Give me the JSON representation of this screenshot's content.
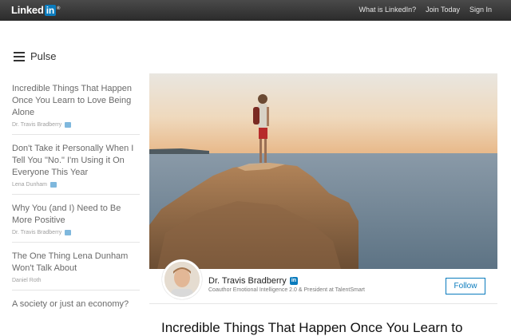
{
  "header": {
    "logo_text": "Linked",
    "logo_in": "in",
    "logo_reg": "®",
    "links": [
      "What is LinkedIn?",
      "Join Today",
      "Sign In"
    ]
  },
  "pulse": {
    "label": "Pulse"
  },
  "sidebar": {
    "articles": [
      {
        "title": "Incredible Things That Happen Once You Learn to Love Being Alone",
        "author": "Dr. Travis Bradberry"
      },
      {
        "title": "Don't Take it Personally When I Tell You \"No.\" I'm Using it On Everyone This Year",
        "author": "Lena Dunham"
      },
      {
        "title": "Why You (and I) Need to Be More Positive",
        "author": "Dr. Travis Bradberry"
      },
      {
        "title": "The One Thing Lena Dunham Won't Talk About",
        "author": "Daniel Roth"
      },
      {
        "title": "A society or just an economy?",
        "author": ""
      }
    ]
  },
  "author": {
    "name": "Dr. Travis Bradberry",
    "badge": "in",
    "title": "Coauthor Emotional Intelligence 2.0 & President at TalentSmart",
    "follow_label": "Follow"
  },
  "article": {
    "headline": "Incredible Things That Happen Once You Learn to"
  },
  "colors": {
    "linkedin_blue": "#0a7bbd",
    "topbar": "#2b2b2b"
  }
}
